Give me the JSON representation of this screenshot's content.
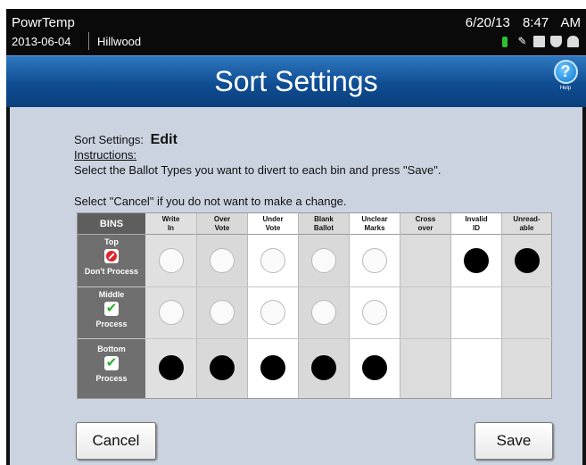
{
  "status_bar": {
    "app_name": "PowrTemp",
    "date": "2013-06-04",
    "location": "Hillwood",
    "datetime": "6/20/13 8:47 AM",
    "icons": [
      "battery-icon",
      "power-plug-icon",
      "document-icon",
      "shield-icon",
      "lock-icon"
    ]
  },
  "header": {
    "title": "Sort Settings",
    "help_label": "Help"
  },
  "main": {
    "label": "Sort Settings:",
    "mode": "Edit",
    "instructions_title": "Instructions:",
    "instruction_line1": "Select the Ballot Types you want to divert to each bin and press \"Save\".",
    "instruction_line2": "Select \"Cancel\" if you do not want to make a change."
  },
  "grid": {
    "bins_header": "BINS",
    "columns": [
      {
        "line1": "Write",
        "line2": "In"
      },
      {
        "line1": "Over",
        "line2": "Vote"
      },
      {
        "line1": "Under",
        "line2": "Vote"
      },
      {
        "line1": "Blank",
        "line2": "Ballot"
      },
      {
        "line1": "Unclear",
        "line2": "Marks"
      },
      {
        "line1": "Cross",
        "line2": "over"
      },
      {
        "line1": "Invalid",
        "line2": "ID"
      },
      {
        "line1": "Unread-",
        "line2": "able"
      }
    ],
    "rows": [
      {
        "name": "Top",
        "action": "Don't Process",
        "icon": "no-entry-icon",
        "cells": [
          "empty",
          "empty",
          "empty",
          "empty",
          "empty",
          "none",
          "filled",
          "filled"
        ]
      },
      {
        "name": "Middle",
        "action": "Process",
        "icon": "checkmark-icon",
        "cells": [
          "empty",
          "empty",
          "empty",
          "empty",
          "empty",
          "none",
          "none",
          "none"
        ]
      },
      {
        "name": "Bottom",
        "action": "Process",
        "icon": "checkmark-icon",
        "cells": [
          "filled",
          "filled",
          "filled",
          "filled",
          "filled",
          "none",
          "none",
          "none"
        ]
      }
    ]
  },
  "buttons": {
    "cancel_label": "Cancel",
    "save_label": "Save"
  }
}
